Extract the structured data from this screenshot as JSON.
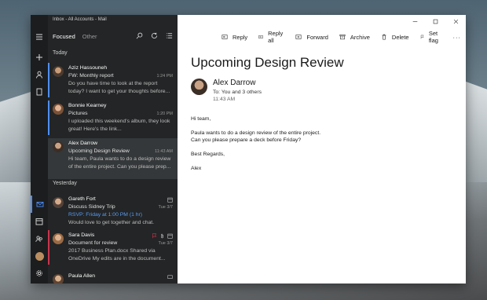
{
  "window": {
    "title": "Inbox - All Accounts - Mail"
  },
  "list": {
    "filter_focused": "Focused",
    "filter_other": "Other",
    "sections": {
      "today": "Today",
      "yesterday": "Yesterday"
    },
    "messages": [
      {
        "sender": "Aziz Hassouneh",
        "subject": "FW: Monthly report",
        "time": "1:24 PM",
        "preview": "Do you have time to look at the report today? I want to get your thoughts before..."
      },
      {
        "sender": "Bonnie Kearney",
        "subject": "Pictures",
        "time": "1:20 PM",
        "preview": "I uploaded this weekend's album, they look great! Here's the link..."
      },
      {
        "sender": "Alex Darrow",
        "subject": "Upcoming Design Review",
        "time": "11:43 AM",
        "preview": "Hi team, Paula wants to do a design review of the entire project. Can you please prep..."
      },
      {
        "sender": "Gareth Fort",
        "subject": "Discuss Sidney Trip",
        "time": "Tue 3/7",
        "preview_highlight": "RSVP: Friday at 1:00 PM (1 hr)",
        "preview": "Would love to get together and chat."
      },
      {
        "sender": "Sara Davis",
        "subject": "Document for review",
        "time": "Tue 3/7",
        "preview": "2017 Business Plan.docx Shared via OneDrive My edits are in the document..."
      },
      {
        "sender": "Paula Allen",
        "subject": "",
        "time": "",
        "preview": ""
      }
    ]
  },
  "commands": {
    "reply": "Reply",
    "reply_all": "Reply all",
    "forward": "Forward",
    "archive": "Archive",
    "delete": "Delete",
    "set_flag": "Set flag",
    "more": "···"
  },
  "mail": {
    "title": "Upcoming Design Review",
    "from": "Alex Darrow",
    "to": "To: You and 3 others",
    "date": "11:43 AM",
    "greeting": "Hi team,",
    "line1": "Paula wants to do a design review of the entire project.",
    "line2": "Can you please prepare a deck before Friday?",
    "closing": "Best Regards,",
    "signature": "Alex"
  },
  "colors": {
    "accent": "#4f8ef7",
    "list_bg": "#232526",
    "rail_bg": "#1b1d1f",
    "calendar_text": "#5a9cf2",
    "flag": "#c9344c"
  }
}
